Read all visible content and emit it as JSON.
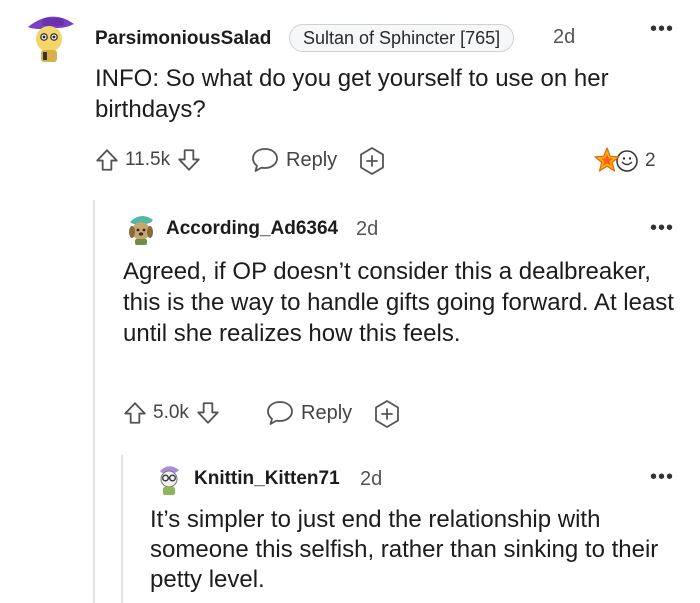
{
  "comments": [
    {
      "username": "ParsimoniousSalad",
      "flair": "Sultan of Sphincter [765]",
      "time": "2d",
      "body": "INFO: So what do you get yourself to use on her birthdays?",
      "votes": "11.5k",
      "reply_label": "Reply",
      "awards_count": "2"
    },
    {
      "username": "According_Ad6364",
      "time": "2d",
      "body": "Agreed, if OP doesn’t consider this a dealbreaker, this is the way to handle gifts going forward. At least until she realizes how this feels.",
      "votes": "5.0k",
      "reply_label": "Reply"
    },
    {
      "username": "Knittin_Kitten71",
      "time": "2d",
      "body": "It’s simpler to just end the relationship with someone this selfish, rather than sinking to their petty level."
    }
  ],
  "icons": {
    "more": "more-options-icon",
    "upvote": "upvote-arrow-icon",
    "downvote": "downvote-arrow-icon",
    "reply": "speech-bubble-icon",
    "award": "award-plus-icon",
    "awards": "award-stars-icon"
  }
}
